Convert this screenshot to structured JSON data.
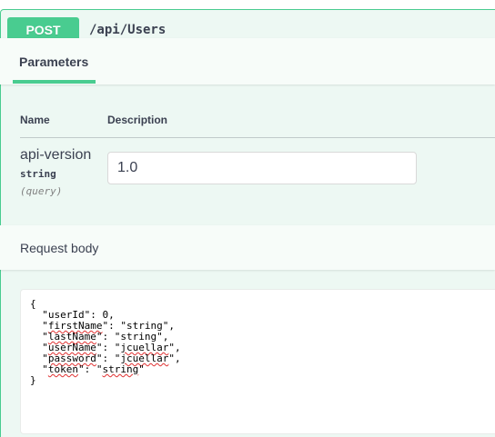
{
  "operation": {
    "method": "POST",
    "path": "/api/Users",
    "accent_color": "#49cc90"
  },
  "parameters_tab": {
    "label": "Parameters"
  },
  "table": {
    "col_name": "Name",
    "col_description": "Description"
  },
  "param": {
    "name": "api-version",
    "type": "string",
    "in": "(query)",
    "value": "1.0"
  },
  "request_body": {
    "label": "Request body",
    "lines": [
      "{",
      "  \"userId\": 0,",
      "  \"firstName\": \"string\",",
      "  \"lastName\": \"string\",",
      "  \"userName\": \"jcuellar\",",
      "  \"password\": \"jcuellar\",",
      "  \"token\": \"string\"",
      "}"
    ]
  }
}
